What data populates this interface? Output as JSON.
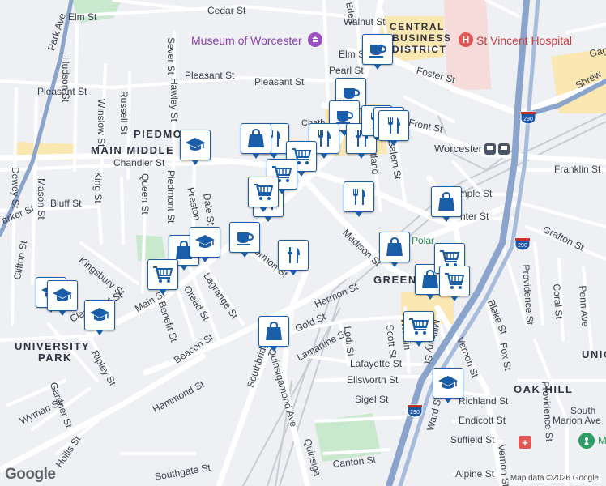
{
  "map": {
    "attribution": "Map data ©2026 Google",
    "logo": "Google",
    "colors": {
      "road": "#ffffff",
      "highway": "#8aa4cc",
      "rail": "#c9ccd3",
      "park": "#c9e9cf",
      "hospital": "#f7dada",
      "district": "#fbe7b2",
      "background": "#eef0f3",
      "pin": "#1a5ea8"
    }
  },
  "places": {
    "museum": "Museum of Worcester",
    "hospital": "St Vincent Hospital",
    "cbd_line1": "CENTRAL",
    "cbd_line2": "BUSINESS",
    "cbd_line3": "DISTRICT",
    "worcester_station": "Worcester",
    "polar": "Polar"
  },
  "areas": {
    "piedmont": "PIEDMONT",
    "main_middle": "MAIN MIDDLE",
    "green": "GREEN",
    "university_park_1": "UNIVERSITY",
    "university_park_2": "PARK",
    "oak_hill": "OAK HILL",
    "union": "UNIO"
  },
  "streets": {
    "elm_w": "Elm St",
    "cedar": "Cedar St",
    "walnut": "Walnut St",
    "eden": "Eden",
    "park_ave": "Park Ave",
    "pleasant_w": "Pleasant St",
    "pleasant_e": "Pleasant St",
    "hudson": "Hudson St",
    "sever": "Sever St",
    "hawley": "Hawley St",
    "russell": "Russell St",
    "winslow": "Winslow St",
    "west": "West St",
    "elm_e": "Elm St",
    "pearl": "Pearl St",
    "foster": "Foster St",
    "front": "Front St",
    "chatham": "Chath",
    "chandler": "Chandler St",
    "dewey": "Dewey St",
    "mason": "Mason St",
    "king": "King St",
    "queen": "Queen St",
    "piedmont": "Piedmont St",
    "preston": "Preston",
    "dale": "Dale St",
    "bluff": "Bluff St",
    "kingsbury": "Kingsbury St",
    "parker": "arker St",
    "clifton": "Clifton St",
    "claremont": "Claremont St",
    "main": "Main St",
    "benefit": "Benefit St",
    "oread": "Oread St",
    "lagrange": "Lagrange St",
    "beacon": "Beacon St",
    "hermon": "Hermon St",
    "hermon2": "Hermon St",
    "gold": "Gold St",
    "lamartine": "Lamartine St",
    "lodi": "Lodi St",
    "scott": "Scott St",
    "washington": "Washin",
    "millbury": "Millbury St",
    "vernon": "Vernon St",
    "fox": "Fox St",
    "blake": "Blake St",
    "lafayette": "Lafayette St",
    "ellsworth": "Ellsworth St",
    "sigel": "Sigel St",
    "richland": "Richland St",
    "endicott": "Endicott St",
    "suffield": "Suffield St",
    "south_marion": "South",
    "marion": "Marion Ave",
    "ward": "Ward St",
    "canton": "Canton St",
    "alpine": "Alpine St",
    "southgate": "Southgate St",
    "hammond": "Hammond St",
    "ripley": "Ripley St",
    "gardner": "Gardner St",
    "wyman": "Wyman St",
    "hollis": "Hollis St",
    "southbridge": "Southbridge",
    "quinsigamond": "Quinsigamond Ave",
    "quinsig2": "Quinsiga",
    "madison": "Madison St",
    "portland": "Portland",
    "salem": "Salem St",
    "temple": "emple St",
    "winter": "nter St",
    "franklin": "Franklin St",
    "grafton": "Grafton St",
    "providence": "Providence St",
    "coral": "Coral St",
    "penn": "Penn Ave",
    "shrewsbury": "Shrew",
    "gage": "Gage",
    "ingalls": "ck St",
    "vernon2": "Vernon St",
    "providence2": "Providence St",
    "main2": "Ma",
    "oread2": "ve St"
  },
  "highways": {
    "i290_a": "290",
    "i290_b": "290",
    "i290_c": "290",
    "i290_d": "290"
  },
  "pins": [
    {
      "type": "coffee-icon"
    },
    {
      "type": "coffee-icon"
    },
    {
      "type": "coffee-icon"
    },
    {
      "type": "coffee-icon"
    },
    {
      "type": "restaurant-icon"
    },
    {
      "type": "restaurant-icon"
    },
    {
      "type": "restaurant-icon"
    },
    {
      "type": "restaurant-icon"
    },
    {
      "type": "restaurant-icon"
    },
    {
      "type": "restaurant-icon"
    },
    {
      "type": "restaurant-icon"
    },
    {
      "type": "restaurant-icon"
    },
    {
      "type": "restaurant-icon"
    },
    {
      "type": "shopping-bag-icon"
    },
    {
      "type": "shopping-bag-icon"
    },
    {
      "type": "shopping-bag-icon"
    },
    {
      "type": "shopping-bag-icon"
    },
    {
      "type": "shopping-bag-icon"
    },
    {
      "type": "shopping-bag-icon"
    },
    {
      "type": "grocery-cart-icon"
    },
    {
      "type": "grocery-cart-icon"
    },
    {
      "type": "grocery-cart-icon"
    },
    {
      "type": "grocery-cart-icon"
    },
    {
      "type": "grocery-cart-icon"
    },
    {
      "type": "grocery-cart-icon"
    },
    {
      "type": "grocery-cart-icon"
    },
    {
      "type": "school-icon"
    },
    {
      "type": "school-icon"
    },
    {
      "type": "school-icon"
    },
    {
      "type": "school-icon"
    },
    {
      "type": "school-icon"
    },
    {
      "type": "school-icon"
    }
  ]
}
